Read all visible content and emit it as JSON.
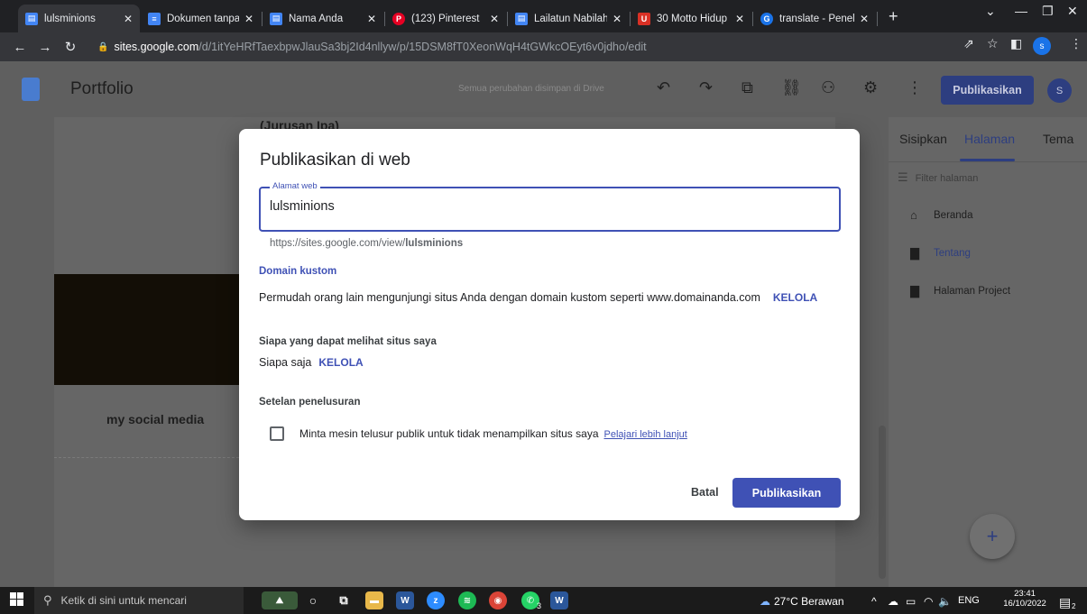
{
  "browser": {
    "tabs": [
      {
        "title": "lulsminions",
        "favicon": "google-sites-icon",
        "color": "#4285f4",
        "active": true
      },
      {
        "title": "Dokumen tanpa j",
        "favicon": "google-docs-icon",
        "color": "#4285f4",
        "active": false
      },
      {
        "title": "Nama Anda",
        "favicon": "google-sites-icon",
        "color": "#4285f4",
        "active": false
      },
      {
        "title": "(123) Pinterest",
        "favicon": "pinterest-icon",
        "color": "#e60023",
        "active": false
      },
      {
        "title": "Lailatun Nabilah",
        "favicon": "google-sites-icon",
        "color": "#4285f4",
        "active": false
      },
      {
        "title": "30 Motto Hidup",
        "favicon": "magnet-icon",
        "color": "#d93025",
        "active": false
      },
      {
        "title": "translate - Penel",
        "favicon": "google-icon",
        "color": "#1a73e8",
        "active": false
      }
    ],
    "url_host": "sites.google.com",
    "url_path": "/d/1itYeHRfTaexbpwJlauSa3bj2Id4nllyw/p/15DSM8fT0XeonWqH4tGWkcOEyt6v0jdho/edit",
    "profile_initial": "s"
  },
  "sites": {
    "title": "Portfolio",
    "saved_note": "Semua perubahan disimpan di Drive",
    "publish_label": "Publikasikan",
    "avatar_initial": "S"
  },
  "canvas": {
    "heading_fragment": "(Jurusan Ipa)",
    "social_label": "my social media"
  },
  "panel": {
    "tabs": [
      "Sisipkan",
      "Halaman",
      "Tema"
    ],
    "active_tab": "Halaman",
    "filter_placeholder": "Filter halaman",
    "pages": [
      {
        "label": "Beranda",
        "icon": "home-icon"
      },
      {
        "label": "Tentang",
        "icon": "page-icon",
        "current": true
      },
      {
        "label": "Halaman Project",
        "icon": "page-icon"
      }
    ]
  },
  "dialog": {
    "title": "Publikasikan di web",
    "field_label": "Alamat web",
    "field_value": "lulsminions",
    "url_prefix": "https://sites.google.com/view/",
    "url_name": "lulsminions",
    "custom_domain_title": "Domain kustom",
    "custom_domain_text": "Permudah orang lain mengunjungi situs Anda dengan domain kustom seperti www.domainanda.com",
    "manage_label": "KELOLA",
    "who_can_view_title": "Siapa yang dapat melihat situs saya",
    "who_can_view_value": "Siapa saja",
    "search_settings_title": "Setelan penelusuran",
    "search_checkbox_text": "Minta mesin telusur publik untuk tidak menampilkan situs saya",
    "learn_more": "Pelajari lebih lanjut",
    "cancel_label": "Batal",
    "publish_label": "Publikasikan",
    "accent_color": "#3f51b5"
  },
  "taskbar": {
    "search_placeholder": "Ketik di sini untuk mencari",
    "weather": "27°C Berawan",
    "language": "ENG",
    "time": "23:41",
    "date": "16/10/2022",
    "whatsapp_badge": "3",
    "notification_count": "2"
  }
}
